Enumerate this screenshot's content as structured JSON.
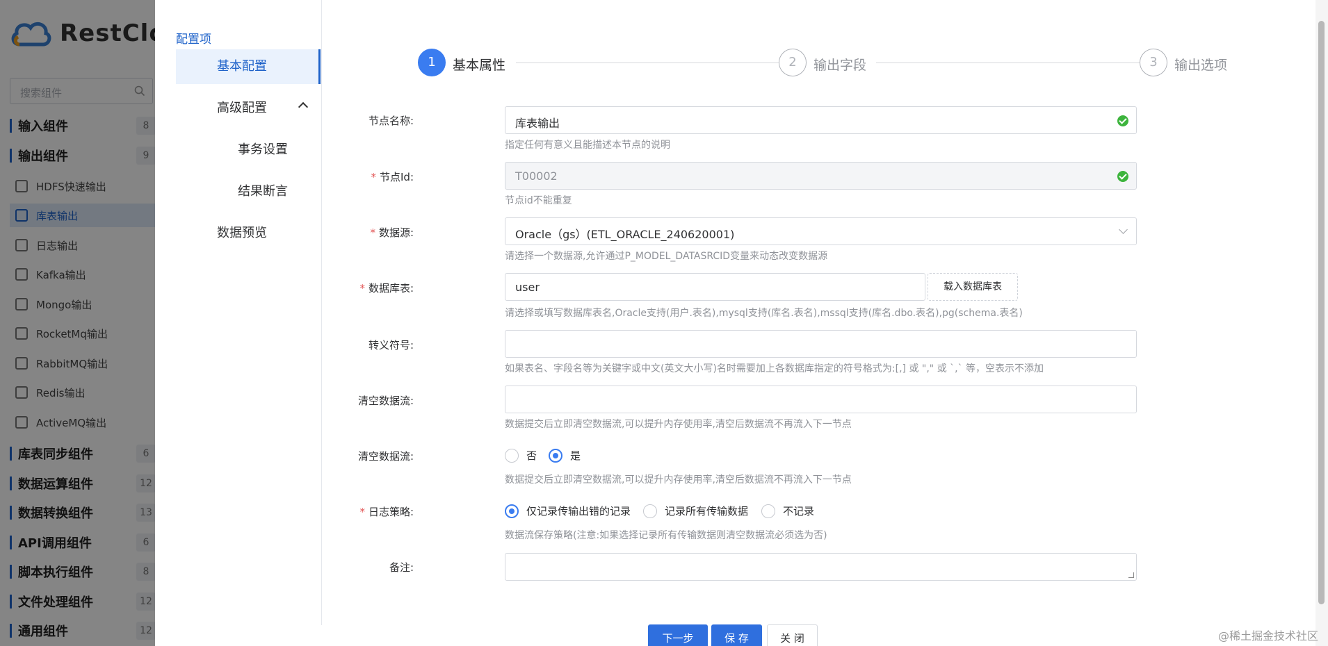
{
  "background_app": {
    "logo_text": "RestClo",
    "search_placeholder": "搜索组件",
    "groups_top": [
      {
        "name": "输入组件",
        "count": "8"
      },
      {
        "name": "输出组件",
        "count": "9"
      }
    ],
    "items": [
      {
        "label": "HDFS快速输出"
      },
      {
        "label": "库表输出"
      },
      {
        "label": "日志输出"
      },
      {
        "label": "Kafka输出"
      },
      {
        "label": "Mongo输出"
      },
      {
        "label": "RocketMq输出"
      },
      {
        "label": "RabbitMQ输出"
      },
      {
        "label": "Redis输出"
      },
      {
        "label": "ActiveMQ输出"
      }
    ],
    "groups_bottom": [
      {
        "name": "库表同步组件",
        "count": "6"
      },
      {
        "name": "数据运算组件",
        "count": "12"
      },
      {
        "name": "数据转换组件",
        "count": "13"
      },
      {
        "name": "API调用组件",
        "count": "6"
      },
      {
        "name": "脚本执行组件",
        "count": "8"
      },
      {
        "name": "文件处理组件",
        "count": "12"
      },
      {
        "name": "通用组件",
        "count": "12"
      }
    ]
  },
  "side_nav": {
    "title": "配置项",
    "items": [
      "基本配置",
      "高级配置",
      "事务设置",
      "结果断言",
      "数据预览"
    ]
  },
  "steps": [
    {
      "num": "1",
      "label": "基本属性"
    },
    {
      "num": "2",
      "label": "输出字段"
    },
    {
      "num": "3",
      "label": "输出选项"
    }
  ],
  "form": {
    "node_name": {
      "label": "节点名称:",
      "value": "库表输出",
      "help": "指定任何有意义且能描述本节点的说明"
    },
    "node_id": {
      "label": "节点Id:",
      "value": "T00002",
      "help": "节点id不能重复"
    },
    "datasource": {
      "label": "数据源:",
      "value": "Oracle（gs）(ETL_ORACLE_240620001)",
      "help": "请选择一个数据源,允许通过P_MODEL_DATASRCID变量来动态改变数据源"
    },
    "db_table": {
      "label": "数据库表:",
      "value": "user",
      "button": "载入数据库表",
      "help": "请选择或填写数据库表名,Oracle支持(用户.表名),mysql支持(库名.表名),mssql支持(库名.dbo.表名),pg(schema.表名)"
    },
    "escape": {
      "label": "转义符号:",
      "value": "",
      "help": "如果表名、字段名等为关键字或中文(英文大小写)名时需要加上各数据库指定的符号格式为:[,] 或 \",\" 或 `,` 等，空表示不添加"
    },
    "clear_flow_input": {
      "label": "清空数据流:",
      "value": "",
      "help": "数据提交后立即清空数据流,可以提升内存使用率,清空后数据流不再流入下一节点"
    },
    "clear_flow_radio": {
      "label": "清空数据流:",
      "options": [
        "否",
        "是"
      ],
      "selected": "是",
      "help": "数据提交后立即清空数据流,可以提升内存使用率,清空后数据流不再流入下一节点"
    },
    "log_policy": {
      "label": "日志策略:",
      "options": [
        "仅记录传输出错的记录",
        "记录所有传输数据",
        "不记录"
      ],
      "selected": "仅记录传输出错的记录",
      "help": "数据流保存策略(注意:如果选择记录所有传输数据则清空数据流必须选为否)"
    },
    "remark": {
      "label": "备注:",
      "value": ""
    }
  },
  "buttons": {
    "next": "下一步",
    "save": "保 存",
    "close": "关 闭"
  },
  "watermark": "@稀土掘金技术社区",
  "colors": {
    "primary": "#2f6fde",
    "accent": "#3a7cf0",
    "ok": "#3db43d",
    "required": "#e25555"
  }
}
